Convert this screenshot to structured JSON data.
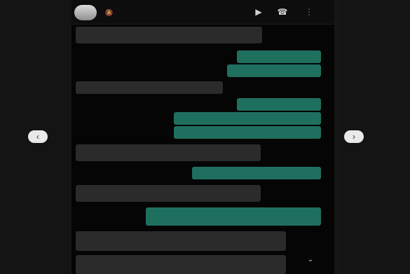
{
  "header": {
    "contact_name": "",
    "status": "",
    "mute_icon": "bell-off-icon",
    "video_icon": "video-camera-icon",
    "call_icon": "phone-icon",
    "menu_icon": "more-vert-icon"
  },
  "navigation": {
    "prev_label": "‹",
    "next_label": "›"
  },
  "messages": [
    {
      "dir": "in",
      "text": "",
      "time": ""
    },
    {
      "dir": "in",
      "text": "",
      "time": ""
    },
    {
      "dir": "out",
      "text": "",
      "time": ""
    },
    {
      "dir": "out",
      "text": "",
      "time": ""
    },
    {
      "dir": "in",
      "text": "",
      "time": ""
    },
    {
      "dir": "in",
      "text": "",
      "time": ""
    },
    {
      "dir": "out",
      "text": "",
      "time": ""
    },
    {
      "dir": "out",
      "text": "",
      "time": ""
    },
    {
      "dir": "out",
      "text": "",
      "time": ""
    },
    {
      "dir": "in",
      "text": "",
      "time": ""
    },
    {
      "dir": "out",
      "text": "",
      "time": ""
    },
    {
      "dir": "in",
      "text": "",
      "time": ""
    },
    {
      "dir": "out",
      "text": "",
      "time": ""
    },
    {
      "dir": "in",
      "text": "",
      "time": ""
    },
    {
      "dir": "in",
      "text": "",
      "time": ""
    }
  ],
  "colors": {
    "background": "#050505",
    "incoming_bubble": "#2b2b2b",
    "outgoing_bubble": "#1f6f5f"
  }
}
